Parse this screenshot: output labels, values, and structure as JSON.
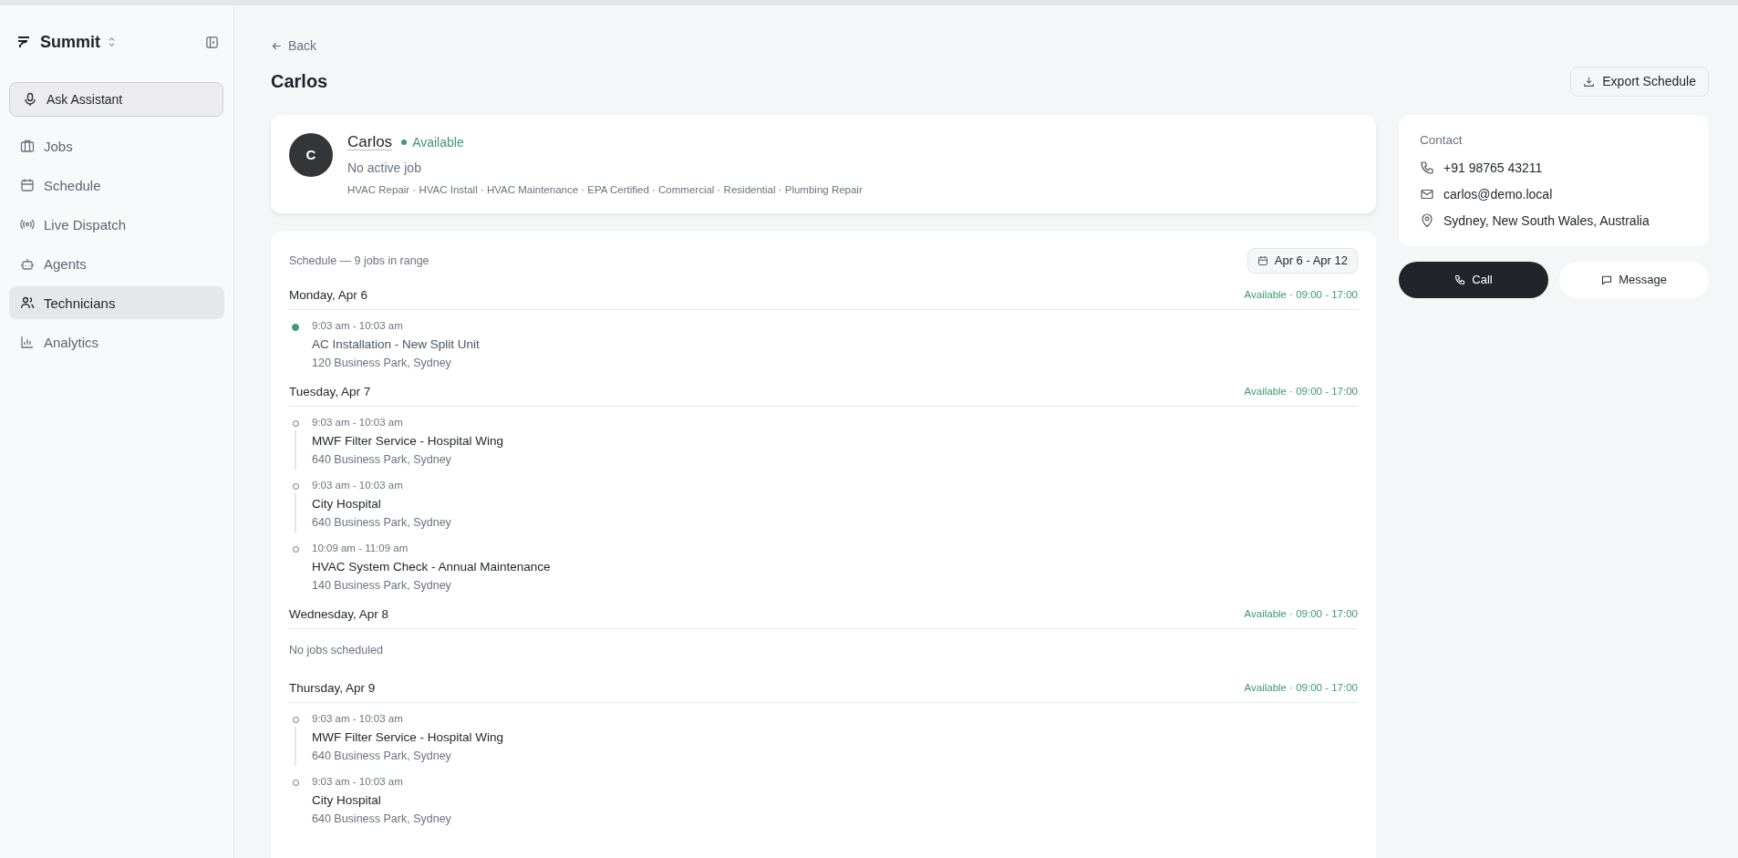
{
  "sidebar": {
    "brand": "Summit",
    "assistant": "Ask Assistant",
    "items": [
      {
        "label": "Jobs",
        "selected": false
      },
      {
        "label": "Schedule",
        "selected": false
      },
      {
        "label": "Live Dispatch",
        "selected": false
      },
      {
        "label": "Agents",
        "selected": false
      },
      {
        "label": "Technicians",
        "selected": true
      },
      {
        "label": "Analytics",
        "selected": false
      }
    ]
  },
  "header": {
    "back": "Back",
    "title": "Carlos",
    "export": "Export Schedule"
  },
  "profile": {
    "initial": "C",
    "name": "Carlos",
    "status": "Available",
    "job": "No active job",
    "skills": "HVAC Repair · HVAC Install · HVAC Maintenance · EPA Certified · Commercial · Residential · Plumbing Repair"
  },
  "schedule": {
    "summary": "Schedule — 9 jobs in range",
    "range": "Apr 6 - Apr 12",
    "days": [
      {
        "day": "Monday, Apr 6",
        "availability": "Available · 09:00 - 17:00",
        "jobs": [
          {
            "time": "9:03 am - 10:03 am",
            "title": "AC Installation - New Split Unit",
            "address": "120 Business Park, Sydney",
            "completed": true
          }
        ]
      },
      {
        "day": "Tuesday, Apr 7",
        "availability": "Available · 09:00 - 17:00",
        "jobs": [
          {
            "time": "9:03 am - 10:03 am",
            "title": "MWF Filter Service - Hospital Wing",
            "address": "640 Business Park, Sydney",
            "completed": false
          },
          {
            "time": "9:03 am - 10:03 am",
            "title": "City Hospital",
            "address": "640 Business Park, Sydney",
            "completed": false
          },
          {
            "time": "10:09 am - 11:09 am",
            "title": "HVAC System Check - Annual Maintenance",
            "address": "140 Business Park, Sydney",
            "completed": false
          }
        ]
      },
      {
        "day": "Wednesday, Apr 8",
        "availability": "Available · 09:00 - 17:00",
        "empty": "No jobs scheduled"
      },
      {
        "day": "Thursday, Apr 9",
        "availability": "Available · 09:00 - 17:00",
        "jobs": [
          {
            "time": "9:03 am - 10:03 am",
            "title": "MWF Filter Service - Hospital Wing",
            "address": "640 Business Park, Sydney",
            "completed": false
          },
          {
            "time": "9:03 am - 10:03 am",
            "title": "City Hospital",
            "address": "640 Business Park, Sydney",
            "completed": false
          }
        ]
      }
    ]
  },
  "contact": {
    "heading": "Contact",
    "phone": "+91 98765 43211",
    "email": "carlos@demo.local",
    "location": "Sydney, New South Wales, Australia"
  },
  "actions": {
    "call": "Call",
    "message": "Message"
  }
}
